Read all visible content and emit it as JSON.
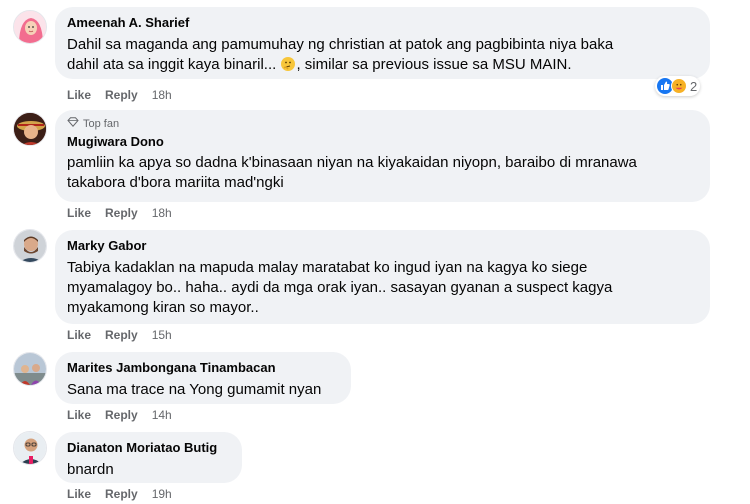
{
  "comments": [
    {
      "author": "Ameenah A. Sharief",
      "text": "Dahil sa maganda ang pamumuhay ng christian at patok ang pagbibinta niya baka\ndahil ata sa inggit kaya binaril...",
      "text_tail": ", similar sa previous issue sa MSU MAIN.",
      "like": "Like",
      "reply": "Reply",
      "time": "18h",
      "reaction_count": "2"
    },
    {
      "badge": "Top fan",
      "author": "Mugiwara Dono",
      "text": "pamliin ka apya so dadna k'binasaan niyan na kiyakaidan niyopn, baraibo di mranawa\ntakabora d'bora mariita mad'ngki",
      "like": "Like",
      "reply": "Reply",
      "time": "18h"
    },
    {
      "author": "Marky Gabor",
      "text": "Tabiya kadaklan na mapuda malay maratabat ko ingud iyan na kagya ko siege\nmyamalagoy bo.. haha.. aydi da mga orak iyan.. sasayan gyanan a suspect kagya\nmyakamong kiran so mayor..",
      "like": "Like",
      "reply": "Reply",
      "time": "15h"
    },
    {
      "author": "Marites Jambongana Tinambacan",
      "text": "Sana ma trace na Yong gumamit nyan",
      "like": "Like",
      "reply": "Reply",
      "time": "14h"
    },
    {
      "author": "Dianaton Moriatao Butig",
      "text": "bnardn",
      "like": "Like",
      "reply": "Reply",
      "time": "19h"
    }
  ],
  "icons": {
    "c0_avatar": "hijab-avatar-icon",
    "reaction_1": "like-icon",
    "reaction_2": "care-icon",
    "thinking_emoji": "thinking-face-icon",
    "topfan": "diamond-icon"
  },
  "colors": {
    "bubble": "#f0f2f5",
    "secondary_text": "#65676b",
    "like_blue": "#1877f2",
    "care_yellow": "#f7b125"
  }
}
